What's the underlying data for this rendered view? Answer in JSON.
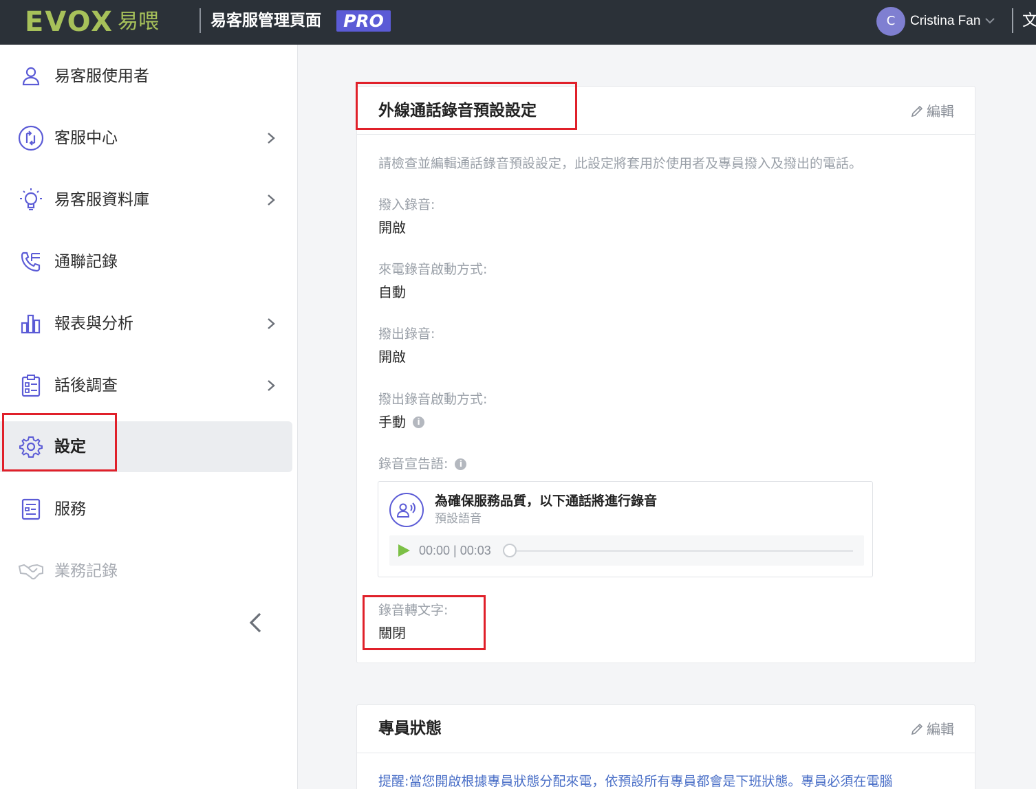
{
  "topbar": {
    "logo_en": "EVOX",
    "logo_zh": "易喂",
    "page_title": "易客服管理頁面",
    "pro_badge": "PRO",
    "avatar_initial": "C",
    "user_name": "Cristina Fan",
    "lang_icon": "文"
  },
  "sidebar": {
    "items": [
      {
        "label": "易客服使用者",
        "icon": "user-icon"
      },
      {
        "label": "客服中心",
        "icon": "call-center-icon"
      },
      {
        "label": "易客服資料庫",
        "icon": "lightbulb-icon"
      },
      {
        "label": "通聯記錄",
        "icon": "phone-log-icon"
      },
      {
        "label": "報表與分析",
        "icon": "bar-chart-icon"
      },
      {
        "label": "話後調查",
        "icon": "clipboard-icon"
      },
      {
        "label": "設定",
        "icon": "gear-icon"
      },
      {
        "label": "服務",
        "icon": "document-icon"
      },
      {
        "label": "業務記錄",
        "icon": "handshake-icon"
      }
    ]
  },
  "recording_card": {
    "title": "外線通話錄音預設設定",
    "edit_label": "編輯",
    "description": "請檢查並編輯通話錄音預設設定，此設定將套用於使用者及專員撥入及撥出的電話。",
    "fields": [
      {
        "label": "撥入錄音:",
        "value": "開啟"
      },
      {
        "label": "來電錄音啟動方式:",
        "value": "自動"
      },
      {
        "label": "撥出錄音:",
        "value": "開啟"
      },
      {
        "label": "撥出錄音啟動方式:",
        "value": "手動"
      }
    ],
    "announcement_label": "錄音宣告語:",
    "audio": {
      "title": "為確保服務品質，以下通話將進行錄音",
      "subtitle": "預設語音",
      "time": "00:00 | 00:03",
      "progress": 0
    },
    "transcription_label": "錄音轉文字:",
    "transcription_value": "關閉"
  },
  "agent_status_card": {
    "title": "專員狀態",
    "edit_label": "編輯",
    "reminder": "提醒:當您開啟根據專員狀態分配來電，依預設所有專員都會是下班狀態。專員必須在電腦"
  },
  "colors": {
    "accent": "#5b5bd6",
    "logo_green": "#a7c15a",
    "highlight_red": "#e0202a",
    "reminder_blue": "#4a6fc7"
  }
}
